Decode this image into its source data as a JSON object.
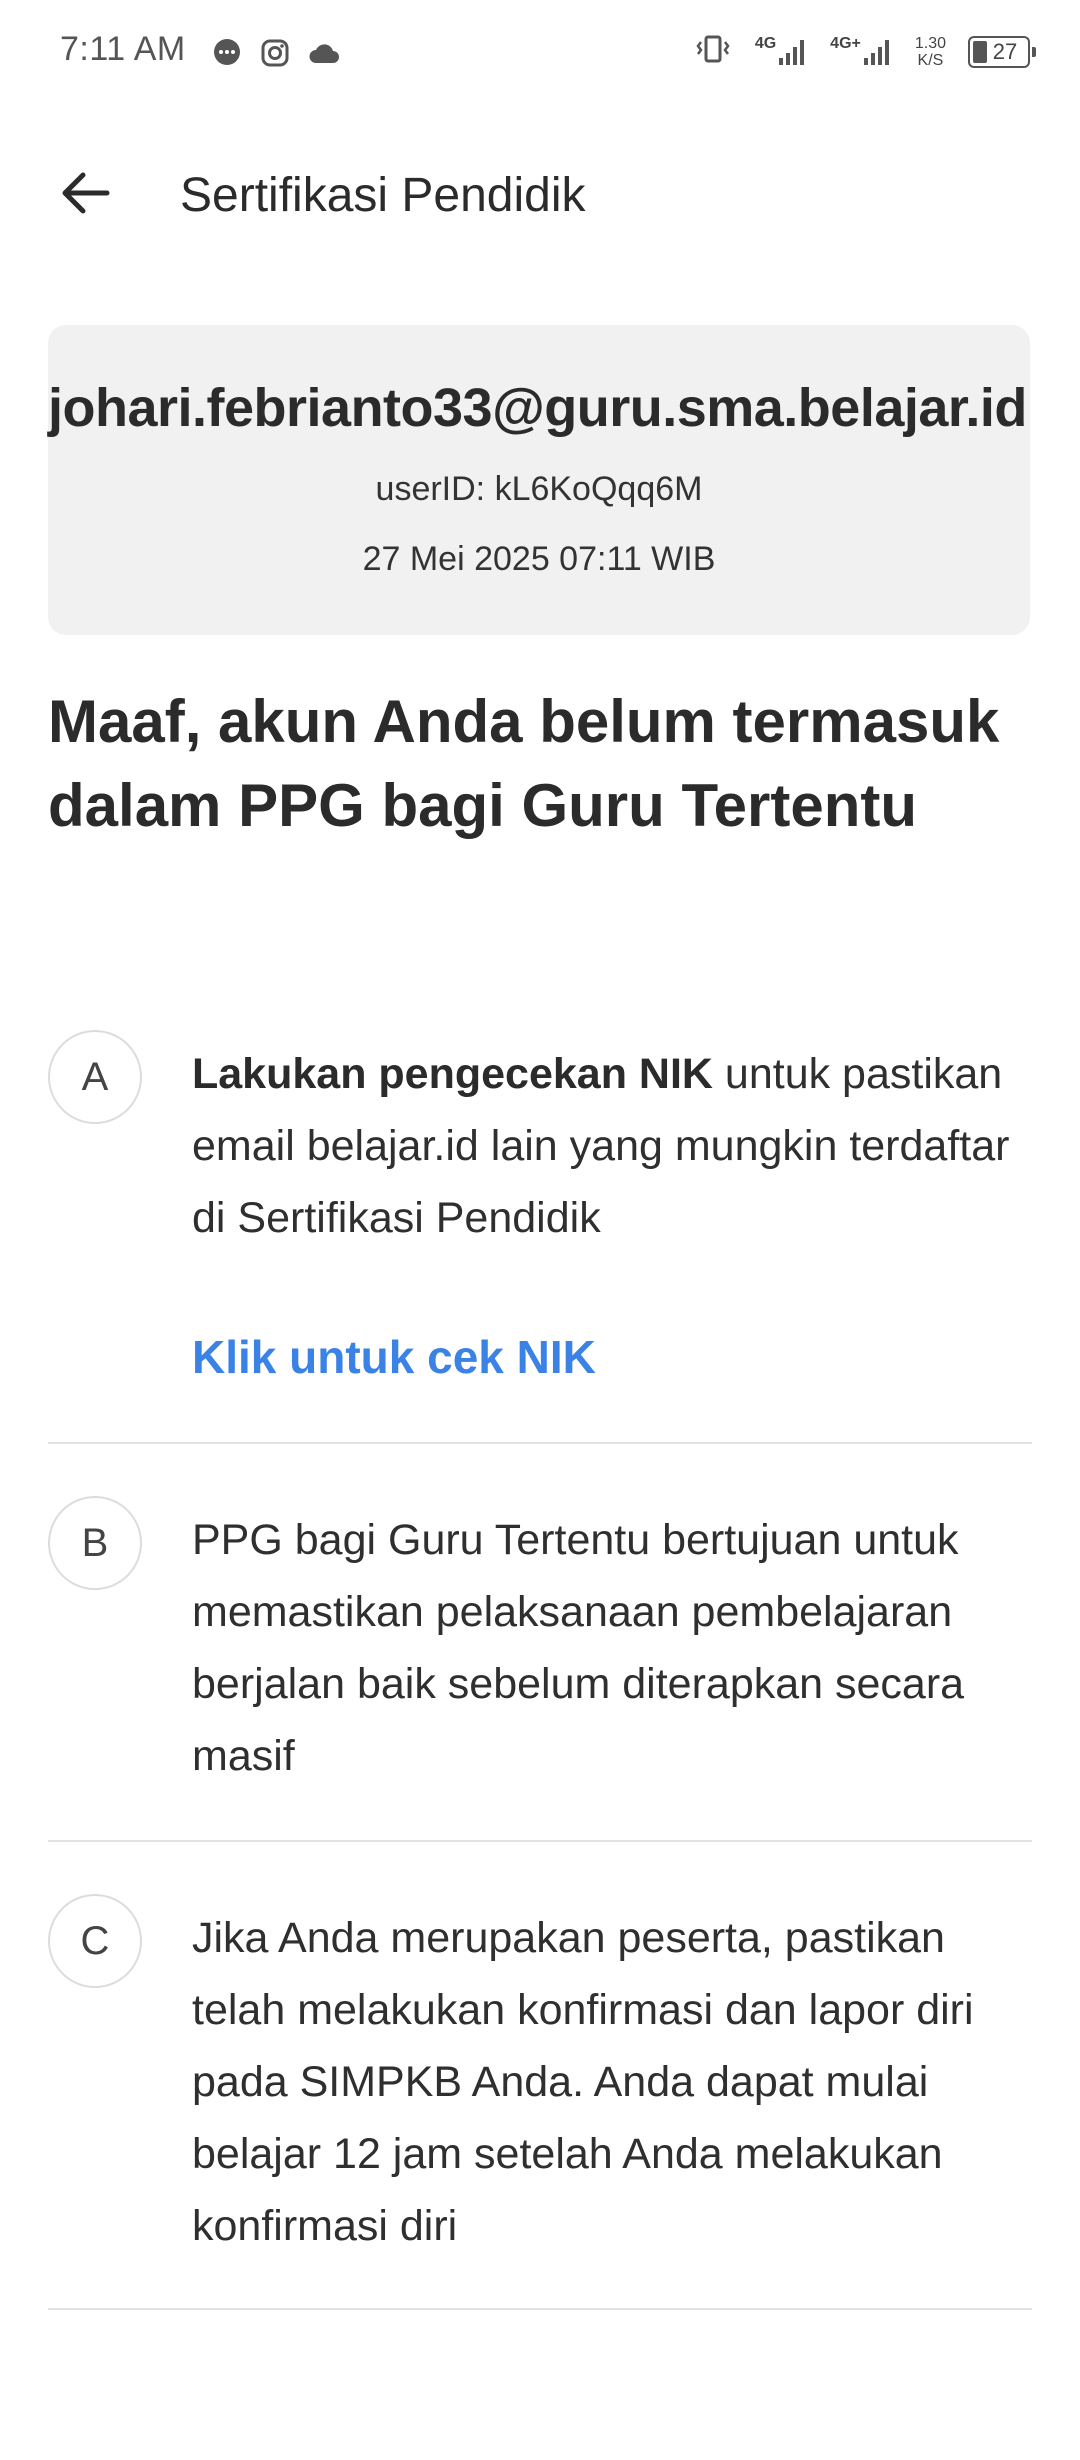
{
  "status_bar": {
    "time": "7:11 AM",
    "left_icons": [
      "chat-bubble-icon",
      "instagram-icon",
      "cloud-icon"
    ],
    "network_1": "4G",
    "network_2": "4G+",
    "speed_value": "1.30",
    "speed_unit": "K/S",
    "battery": "27"
  },
  "app_bar": {
    "title": "Sertifikasi Pendidik"
  },
  "account": {
    "email": "johari.febrianto33@guru.sma.belajar.id",
    "user_id": "userID: kL6KoQqq6M",
    "timestamp": "27 Mei 2025 07:11 WIB"
  },
  "heading": "Maaf, akun Anda belum termasuk dalam PPG bagi Guru Tertentu",
  "steps": [
    {
      "letter": "A",
      "bold": "Lakukan pengecekan NIK",
      "text": " untuk pastikan email belajar.id lain yang mungkin terdaftar di Sertifikasi Pendidik",
      "link": "Klik untuk cek NIK"
    },
    {
      "letter": "B",
      "text": "PPG bagi Guru Tertentu bertujuan untuk memastikan pelaksanaan pembelajaran berjalan baik sebelum diterapkan secara masif"
    },
    {
      "letter": "C",
      "text": "Jika Anda merupakan peserta, pastikan telah melakukan konfirmasi dan lapor diri pada SIMPKB Anda. Anda dapat mulai belajar 12 jam setelah Anda melakukan konfirmasi diri"
    }
  ],
  "colors": {
    "link": "#3b82e6",
    "card_bg": "#f1f1f1",
    "text": "#2b2b2b"
  }
}
